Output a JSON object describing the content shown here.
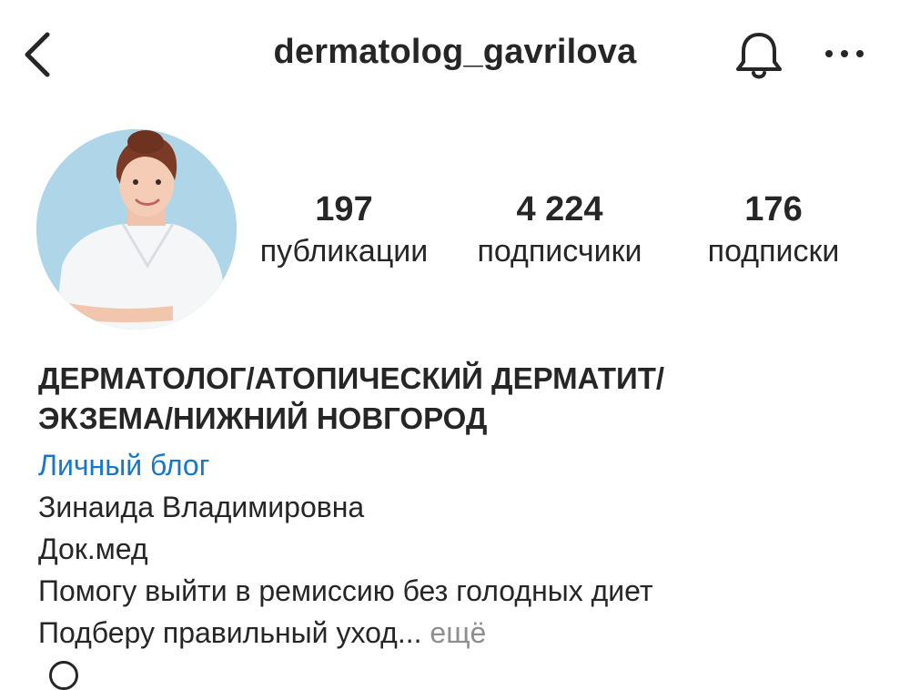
{
  "header": {
    "username": "dermatolog_gavrilova",
    "back_icon": "chevron-left-icon",
    "bell_icon": "bell-icon",
    "more_icon": "more-horizontal-icon"
  },
  "stats": {
    "posts": {
      "value": "197",
      "label": "публикации"
    },
    "followers": {
      "value": "4 224",
      "label": "подписчики"
    },
    "following": {
      "value": "176",
      "label": "подписки"
    }
  },
  "bio": {
    "name_line1": "ДЕРМАТОЛОГ/АТОПИЧЕСКИЙ ДЕРМАТИТ/",
    "name_line2": "ЭКЗЕМА/НИЖНИЙ НОВГОРОД",
    "category": "Личный блог",
    "lines": [
      "Зинаида Владимировна",
      "Док.мед",
      "Помогу выйти в ремиссию без голодных диет",
      "Подберу правильный уход..."
    ],
    "more_label": "ещё"
  },
  "colors": {
    "text": "#262626",
    "link": "#1877c9",
    "muted": "#8e8e8e",
    "avatar_bg": "#a8d2e6"
  }
}
